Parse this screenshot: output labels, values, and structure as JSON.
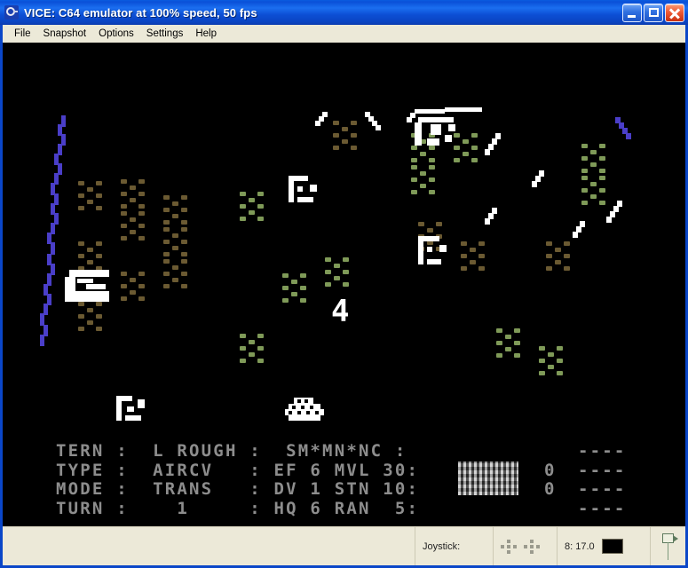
{
  "window": {
    "title": "VICE: C64 emulator at 100% speed, 50 fps",
    "app_icon": "vice-logo-icon",
    "frame_color": "#0a46c8",
    "titlebar_gradient_from": "#1b6ef0",
    "titlebar_gradient_to": "#0c3bb0"
  },
  "titlebar_buttons": {
    "minimize": {
      "name": "minimize-button",
      "glyph": "_"
    },
    "maximize": {
      "name": "maximize-button",
      "glyph": "□"
    },
    "close": {
      "name": "close-button",
      "glyph": "✕"
    }
  },
  "menubar": {
    "items": [
      {
        "label": "File"
      },
      {
        "label": "Snapshot"
      },
      {
        "label": "Options"
      },
      {
        "label": "Settings"
      },
      {
        "label": "Help"
      }
    ]
  },
  "emulator_screen": {
    "background": "#000000",
    "game": "hex wargame map",
    "colors": {
      "rough_terrain": "#6b5a32",
      "forest_terrain": "#7f9a58",
      "river": "#4a3ec8",
      "road": "#ffffff",
      "unit": "#ffffff",
      "status_text": "#8d8d8d"
    },
    "map_glyph": {
      "label": "4"
    }
  },
  "status_panel": {
    "rows": [
      {
        "label": "TERN",
        "sep1": ":",
        "value": " L ROUGH",
        "sep2": ":",
        "extra": "  SM*MN*NC",
        "sep3": ":"
      },
      {
        "label": "TYPE",
        "sep1": ":",
        "value": " AIRCV  ",
        "sep2": ":",
        "extra": " EF 6 MVL 30",
        "sep3": ":"
      },
      {
        "label": "MODE",
        "sep1": ":",
        "value": " TRANS  ",
        "sep2": ":",
        "extra": " DV 1 STN 10",
        "sep3": ":"
      },
      {
        "label": "TURN",
        "sep1": ":",
        "value": "   1    ",
        "sep2": ":",
        "extra": " HQ 6 RAN  5",
        "sep3": ":"
      }
    ],
    "text_block": "TERN :  L ROUGH :  SM*MN*NC :\nTYPE :  AIRCV   : EF 6 MVL 30:\nMODE :  TRANS   : DV 1 STN 10:\nTURN :    1     : HQ 6 RAN  5:",
    "numbers_block": "\n0\n0\n",
    "dashes_block": "----\n----\n----\n----",
    "hatch_block_name": "terrain-swatch"
  },
  "statusbar": {
    "joystick_label": "Joystick:",
    "drive_label": "8: 17.0",
    "drive_led_state": "off",
    "tape_icon": "tape-flag-icon"
  }
}
